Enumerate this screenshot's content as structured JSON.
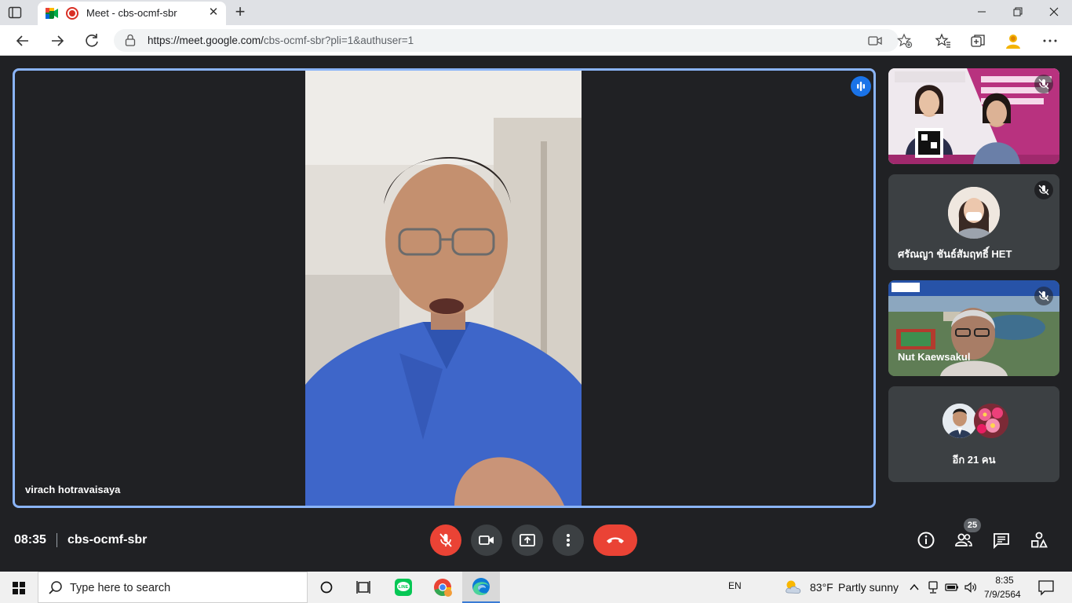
{
  "browser": {
    "tab_title": "Meet - cbs-ocmf-sbr",
    "url_host": "https://meet.google.com/",
    "url_path": "cbs-ocmf-sbr?pli=1&authuser=1",
    "new_tab_symbol": "+",
    "close_symbol": "✕"
  },
  "meet": {
    "main_speaker": "virach hotravaisaya",
    "participants": [
      {
        "name": ""
      },
      {
        "name": "ศรัณญา ชันธ์สัมฤทธิ์ HET"
      },
      {
        "name": "Nut Kaewsakul"
      }
    ],
    "others_label": "อีก 21 คน",
    "time": "08:35",
    "meeting_code": "cbs-ocmf-sbr",
    "people_count": "25"
  },
  "taskbar": {
    "search_placeholder": "Type here to search",
    "language": "EN",
    "weather_temp": "83°F",
    "weather_desc": "Partly sunny",
    "clock_time": "8:35",
    "clock_date": "7/9/2564",
    "line_label": "LINE"
  },
  "colors": {
    "accent": "#8ab4f8",
    "danger": "#ea4335",
    "speaking": "#1a73e8",
    "surface": "#202124"
  },
  "icons": [
    "tab-actions-icon",
    "meet-favicon",
    "record-icon",
    "back-icon",
    "forward-icon",
    "reload-icon",
    "lock-icon",
    "camera-blocked-icon",
    "add-favorite-icon",
    "favorites-icon",
    "collections-icon",
    "profile-icon",
    "more-icon",
    "mic-off-icon",
    "camera-icon",
    "present-icon",
    "more-options-icon",
    "end-call-icon",
    "info-icon",
    "people-icon",
    "chat-icon",
    "activities-icon",
    "windows-start-icon",
    "search-icon",
    "cortana-icon",
    "task-view-icon",
    "line-icon",
    "chrome-icon",
    "edge-icon",
    "weather-icon",
    "chevron-up-icon",
    "network-icon",
    "battery-icon",
    "volume-icon",
    "notifications-icon"
  ]
}
